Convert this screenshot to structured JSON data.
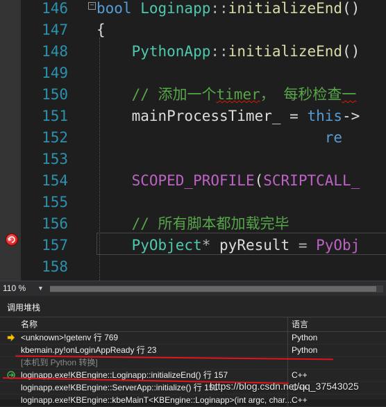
{
  "editor": {
    "lines": [
      {
        "num": "146",
        "code": "bool Loginapp::initializeEnd()"
      },
      {
        "num": "147",
        "code": "{"
      },
      {
        "num": "148",
        "code": "    PythonApp::initializeEnd()"
      },
      {
        "num": "149",
        "code": ""
      },
      {
        "num": "150",
        "code": "    // 添加一个timer， 每秒检查一"
      },
      {
        "num": "151",
        "code": "    mainProcessTimer_ = this->"
      },
      {
        "num": "152",
        "code": "                          re"
      },
      {
        "num": "153",
        "code": ""
      },
      {
        "num": "154",
        "code": "    SCOPED_PROFILE(SCRIPTCALL_"
      },
      {
        "num": "155",
        "code": ""
      },
      {
        "num": "156",
        "code": "    // 所有脚本都加载完毕"
      },
      {
        "num": "157",
        "code": "    PyObject* pyResult = PyObj"
      },
      {
        "num": "158",
        "code": ""
      }
    ],
    "breakpoint_line": "157"
  },
  "zoom": {
    "value": "110 %"
  },
  "call_stack": {
    "title": "调用堆栈",
    "columns": {
      "name": "名称",
      "language": "语言"
    },
    "rows": [
      {
        "name": "<unknown>!getenv 行 769",
        "language": "Python",
        "icon": "yellow-arrow-icon"
      },
      {
        "name": "kbemain.py!onLoginAppReady 行 23",
        "language": "Python",
        "icon": ""
      },
      {
        "name": "[本机到 Python 转换]",
        "language": "",
        "icon": ""
      },
      {
        "name": "loginapp.exe!KBEngine::Loginapp::initializeEnd() 行 157",
        "language": "C++",
        "icon": "green-return-arrow-icon"
      },
      {
        "name": "loginapp.exe!KBEngine::ServerApp::initialize() 行 151",
        "language": "C++",
        "icon": ""
      },
      {
        "name": "loginapp.exe!KBEngine::kbeMainT<KBEngine::Loginapp>(int argc, char...",
        "language": "C++",
        "icon": ""
      }
    ]
  },
  "watermark": "https://blog.csdn.net/qq_37543025",
  "colors": {
    "annotation_red": "#e5131b",
    "keyword": "#569cd6",
    "function": "#dcdcaa",
    "comment": "#57a64a",
    "macro": "#bd63c5"
  }
}
